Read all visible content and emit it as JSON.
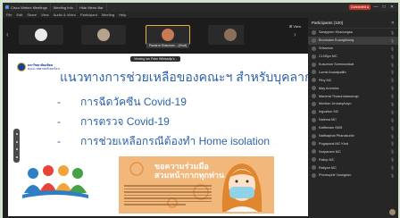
{
  "window": {
    "tabs": [
      {
        "label": "Cisco Webex Meetings"
      },
      {
        "label": "Meeting Info"
      },
      {
        "label": "Hide Menu Bar"
      }
    ],
    "recording_label": "Connected ●",
    "controls": [
      "—",
      "□",
      "✕"
    ]
  },
  "menubar": {
    "items": [
      "File",
      "Edit",
      "Share",
      "View",
      "Audio & Video",
      "Participant",
      "Meeting",
      "Help"
    ]
  },
  "video_strip": {
    "speaker_name": "Pawarut Sinsuwan ...(Host)",
    "viewing_text": "Viewing Ian Palm Wibisadip's...",
    "view_control": "⊞ View"
  },
  "slide": {
    "logo_text_1": "มหาวิทยาลัยมหิดล",
    "logo_text_2": "คณะเวชศาสตร์เขตร้อน",
    "title": "แนวทางการช่วยเหลือของคณะฯ สำหรับบุคลากร",
    "bullets": [
      {
        "dash": "-",
        "text": "การฉีดวัคซีน Covid-19"
      },
      {
        "dash": "-",
        "text": "การตรวจ Covid-19"
      },
      {
        "dash": "-",
        "text": "การช่วยเหลือกรณีต้องทำ Home isolation"
      }
    ],
    "poster_title_1": "ขอความร่วมมือ",
    "poster_title_2": "สวมหน้ากากทุกท่าน"
  },
  "participants": {
    "header": "Participants (100)",
    "list": [
      "Sarayporn Khaoungsa",
      "Boonsiam Kuanghkong",
      "Srisamon",
      "CLN5yo MC",
      "Kusumon Somnoowkat",
      "Lumst Anuwipalith",
      "Pihy MC",
      "May Anomics",
      "Manerat Thasornlaaromap",
      "Montion Ururanphayo",
      "Ingvaiton MC",
      "Nalema MC",
      "Kaiffaman SMS",
      "Natthaphat Phanakurlin",
      "Pogaporal MC Kind",
      "Nurpanam MC",
      "Pallop MC",
      "Ratiyan MC",
      "Phornuphit Vuongsiru"
    ],
    "selected_index": 1
  },
  "colors": {
    "slide_blue": "#2e62a8",
    "panel_bg": "#262626",
    "record_red": "#c0392b"
  }
}
